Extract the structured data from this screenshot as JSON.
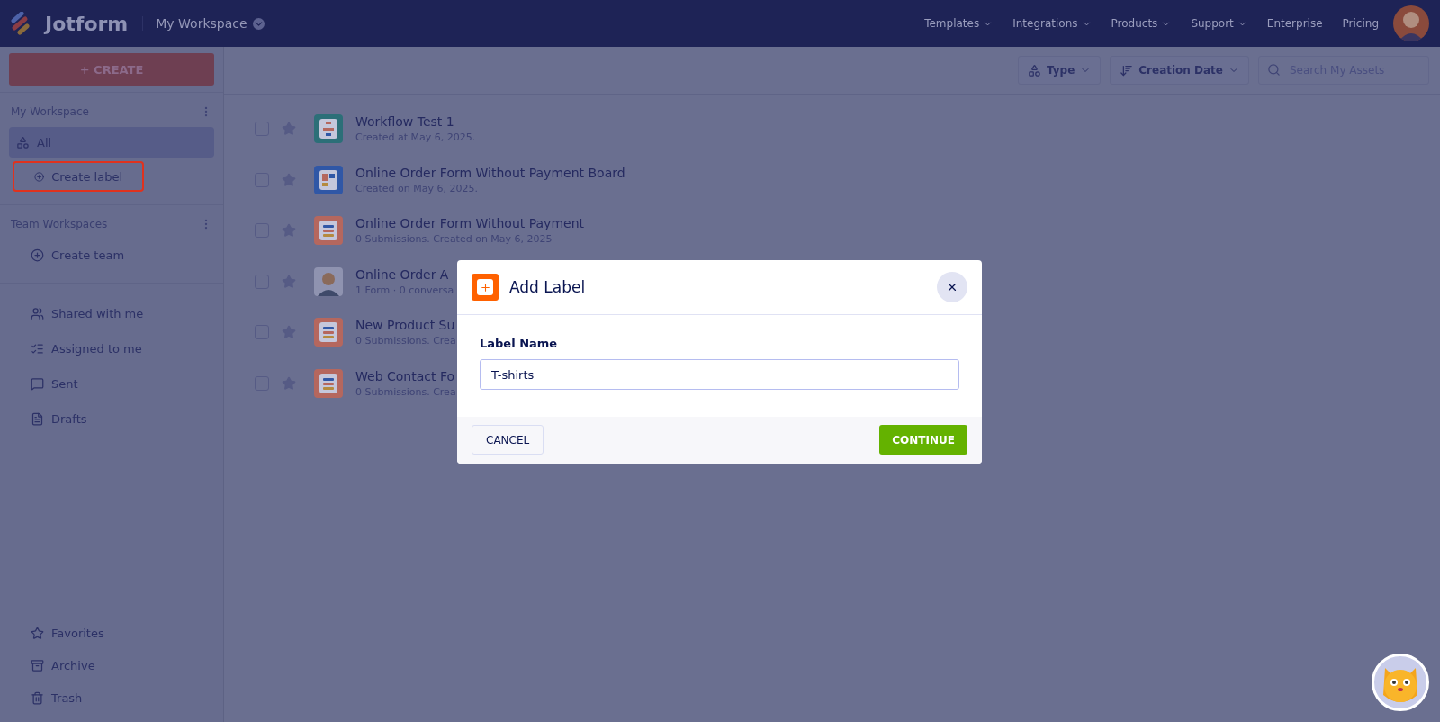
{
  "header": {
    "logo": "Jotform",
    "workspace": "My Workspace",
    "nav": [
      {
        "label": "Templates",
        "dropdown": true
      },
      {
        "label": "Integrations",
        "dropdown": true
      },
      {
        "label": "Products",
        "dropdown": true
      },
      {
        "label": "Support",
        "dropdown": true
      },
      {
        "label": "Enterprise",
        "dropdown": false
      },
      {
        "label": "Pricing",
        "dropdown": false
      }
    ]
  },
  "sidebar": {
    "create_button": "+ CREATE",
    "my_workspace": {
      "title": "My Workspace",
      "items": [
        {
          "label": "All",
          "selected": true,
          "highlighted": false
        },
        {
          "label": "Create label",
          "selected": false,
          "highlighted": true
        }
      ]
    },
    "team_workspaces": {
      "title": "Team Workspaces",
      "items": [
        {
          "label": "Create team",
          "selected": false,
          "highlighted": false
        }
      ]
    },
    "shared": [
      {
        "label": "Shared with me",
        "selected": false
      },
      {
        "label": "Assigned to me",
        "selected": false
      },
      {
        "label": "Sent",
        "selected": false
      },
      {
        "label": "Drafts",
        "selected": false
      }
    ],
    "bottom": [
      {
        "label": "Favorites",
        "selected": false
      },
      {
        "label": "Archive",
        "selected": false
      },
      {
        "label": "Trash",
        "selected": false
      }
    ]
  },
  "toolbar": {
    "type_filter": "Type",
    "sort": "Creation Date",
    "search": {
      "placeholder": "Search My Assets"
    }
  },
  "assets": [
    {
      "kind": "workflow",
      "title": "Workflow Test 1",
      "subtitle": "Created at May 6, 2025.",
      "checked": false,
      "starred": false
    },
    {
      "kind": "board",
      "title": "Online Order Form Without Payment Board",
      "subtitle": "Created on May 6, 2025.",
      "checked": false,
      "starred": false
    },
    {
      "kind": "form",
      "title": "Online Order Form Without Payment",
      "subtitle": "0 Submissions. Created on May 6, 2025",
      "checked": false,
      "starred": false
    },
    {
      "kind": "agent",
      "title": "Online Order A",
      "subtitle": "1 Form · 0 conversa",
      "checked": false,
      "starred": false
    },
    {
      "kind": "form",
      "title": "New Product Su",
      "subtitle": "0 Submissions. Crea",
      "checked": false,
      "starred": false
    },
    {
      "kind": "form",
      "title": "Web Contact Fo",
      "subtitle": "0 Submissions. Crea",
      "checked": false,
      "starred": false
    }
  ],
  "dialog": {
    "title": "Add Label",
    "field_label": "Label Name",
    "value": "T-shirts",
    "cancel": "CANCEL",
    "confirm": "CONTINUE"
  }
}
